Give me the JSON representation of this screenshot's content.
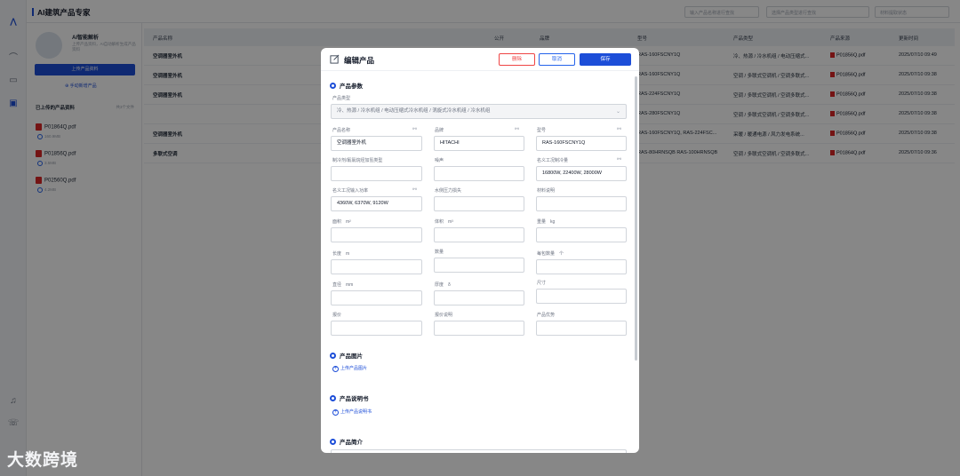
{
  "app": {
    "title": "AI建筑产品专家"
  },
  "topbar": {
    "search_placeholder": "输入产品名称进行查找",
    "type_placeholder": "选择产品类型进行查找",
    "status_placeholder": "材料提取状态"
  },
  "left": {
    "ai_name": "AI智能解析",
    "ai_desc": "上传产品资料，AI自动解析生成产品资料",
    "upload_btn": "上传产品资料",
    "add_link": "手动新增产品",
    "uploaded_title": "已上传的产品资料",
    "uploaded_count": "共3个文件",
    "files": [
      {
        "name": "P01864Q.pdf",
        "size": "160.9MB"
      },
      {
        "name": "P01856Q.pdf",
        "size": "3.5MB"
      },
      {
        "name": "P02560Q.pdf",
        "size": "4.2MB"
      }
    ]
  },
  "table": {
    "headers": [
      "产品名称",
      "公开",
      "品牌",
      "型号",
      "产品类型",
      "产品来源",
      "更新时间"
    ],
    "rows": [
      {
        "name": "空调器室外机",
        "model": "RAS-160FSCNY1Q",
        "type": "冷、热源 / 冷水机组 / 电动压缩式...",
        "source": "P01856Q.pdf",
        "time": "2025/07/10 09:49"
      },
      {
        "name": "空调器室外机",
        "model": "RAS-160FSCNY1Q",
        "type": "空调 / 多联式空调机 / 空调多联式...",
        "source": "P01856Q.pdf",
        "time": "2025/07/10 09:38"
      },
      {
        "name": "空调器室外机",
        "model": "RAS-224FSCNY1Q",
        "type": "空调 / 多联式空调机 / 空调多联式...",
        "source": "P01856Q.pdf",
        "time": "2025/07/10 09:38"
      },
      {
        "name": "",
        "model": "RAS-280FSCNY1Q",
        "type": "空调 / 多联式空调机 / 空调多联式...",
        "source": "P01856Q.pdf",
        "time": "2025/07/10 09:38"
      },
      {
        "name": "空调器室外机",
        "model": "RAS-160FSCNY1Q, RAS-224FSC...",
        "type": "采暖 / 暖通电源 / 风力发电系统...",
        "source": "P01856Q.pdf",
        "time": "2025/07/10 09:38"
      },
      {
        "name": "多联式空调",
        "model": "RAS-80HRNSQB RAS-100HRNSQB",
        "type": "空调 / 多联式空调机 / 空调多联式...",
        "source": "P01864Q.pdf",
        "time": "2025/07/10 09:36"
      }
    ]
  },
  "modal": {
    "title": "编辑产品",
    "delete_label": "删除",
    "cancel_label": "取消",
    "save_label": "保存",
    "sections": {
      "params": "产品参数",
      "images": "产品图片",
      "manual": "产品说明书",
      "intro": "产品简介"
    },
    "upload_image": "上传产品图片",
    "upload_manual": "上传产品说明书",
    "fields": {
      "product_type_label": "产品类型",
      "product_type_value": "冷、热源 / 冷水机组 / 电动压缩式冷水机组 / 涡旋式冷水机组 / 冷水机组",
      "name_label": "产品名称",
      "name_value": "空调器室外机",
      "brand_label": "品牌",
      "brand_value": "HITACHI",
      "model_label": "型号",
      "model_value": "RAS-160FSCNY1Q",
      "refrigerant_label": "制冷剂/氟氯烷烃加氢类型",
      "noise_label": "噪声",
      "cooling_label": "名义工况制冷量",
      "cooling_value": "16800W, 22400W, 28000W",
      "power_label": "名义工况输入功率",
      "power_value": "4360W, 6370W, 9120W",
      "pressure_label": "水侧压力损失",
      "material_label": "材料说明",
      "area_label": "面积",
      "area_unit": "m²",
      "volume_label": "体积",
      "volume_unit": "m³",
      "weight_label": "重量",
      "weight_unit": "kg",
      "length_label": "长度",
      "length_unit": "m",
      "qty_label": "数量",
      "perpack_label": "每包数量",
      "perpack_unit": "个",
      "diameter_label": "直径",
      "diameter_unit": "mm",
      "thickness_label": "厚度",
      "thickness_unit": "δ",
      "size_label": "尺寸",
      "price_label": "报价",
      "price_note_label": "报价说明",
      "advantage_label": "产品优势"
    }
  },
  "watermark": "大数跨境"
}
